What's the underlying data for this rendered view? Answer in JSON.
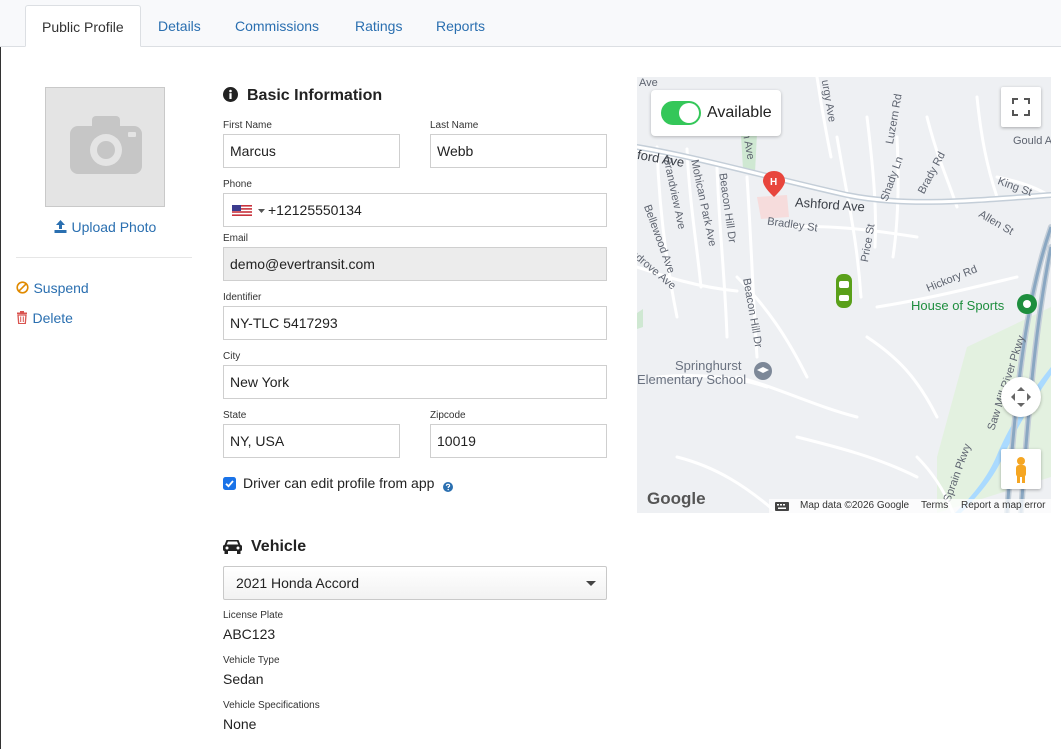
{
  "tabs": [
    "Public Profile",
    "Details",
    "Commissions",
    "Ratings",
    "Reports"
  ],
  "left": {
    "upload_label": "Upload Photo",
    "suspend_label": "Suspend",
    "delete_label": "Delete"
  },
  "basic": {
    "title": "Basic Information",
    "first_name_label": "First Name",
    "first_name": "Marcus",
    "last_name_label": "Last Name",
    "last_name": "Webb",
    "phone_label": "Phone",
    "phone": "+12125550134",
    "email_label": "Email",
    "email": "demo@evertransit.com",
    "identifier_label": "Identifier",
    "identifier": "NY-TLC 5417293",
    "city_label": "City",
    "city": "New York",
    "state_label": "State",
    "state": "NY, USA",
    "zip_label": "Zipcode",
    "zip": "10019",
    "edit_checkbox_label": "Driver can edit profile from app"
  },
  "vehicle": {
    "title": "Vehicle",
    "selected": "2021 Honda Accord",
    "plate_label": "License Plate",
    "plate": "ABC123",
    "type_label": "Vehicle Type",
    "type": "Sedan",
    "specs_label": "Vehicle Specifications",
    "specs": "None"
  },
  "map": {
    "status_label": "Available",
    "google_logo": "Google",
    "footer_data": "Map data ©2026 Google",
    "footer_terms": "Terms",
    "footer_report": "Report a map error",
    "streets": [
      "Ashford Ave",
      "Bradley St",
      "Price St",
      "Beacon Hill Dr",
      "Beacon Hill Dr",
      "Grandview Ave",
      "Mohican Park Ave",
      "Shady Ln",
      "Brady Rd",
      "Luzern Rd",
      "King St",
      "Allen St",
      "Hickory Rd",
      "Gould A",
      "Saw Mill River Pkwy",
      "Sprain Pkwy",
      "ford Ave",
      "Bellewood Ave",
      "Indrove Ave",
      "Ave",
      "urgy Ave",
      "on Ave"
    ],
    "pois": [
      "House of Sports",
      "Springhurst",
      "Elementary School"
    ]
  }
}
